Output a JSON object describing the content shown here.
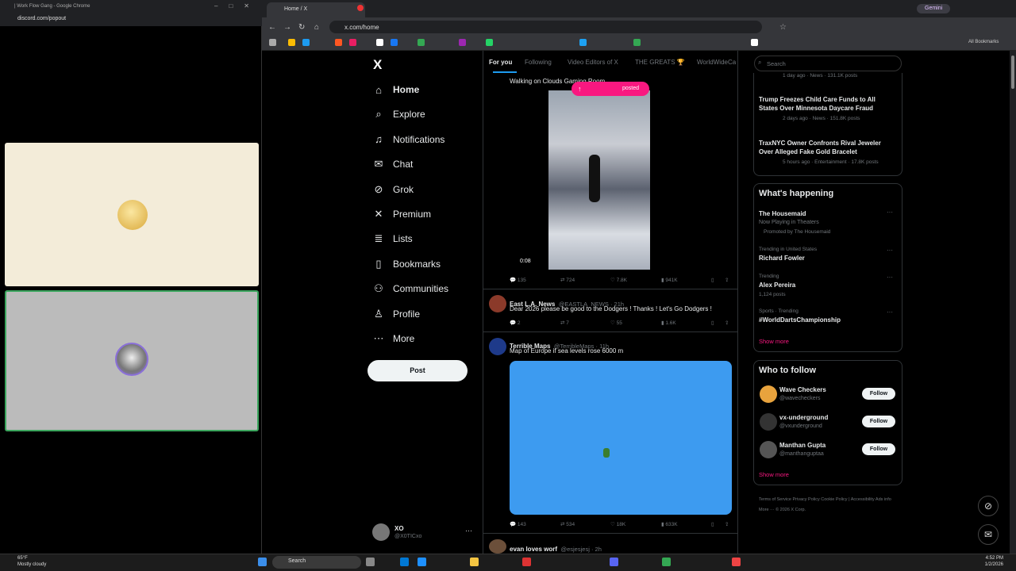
{
  "discord_window": {
    "title": "| Work Flow Gang - Google Chrome",
    "url": "discord.com/popout"
  },
  "browser": {
    "tab_title": "Home / X",
    "url": "x.com/home",
    "gemini_label": "Gemini",
    "all_bookmarks_label": "All Bookmarks"
  },
  "sidebar": {
    "items": [
      {
        "label": "Home",
        "icon": "home-icon"
      },
      {
        "label": "Explore",
        "icon": "search-icon"
      },
      {
        "label": "Notifications",
        "icon": "bell-icon"
      },
      {
        "label": "Chat",
        "icon": "mail-icon"
      },
      {
        "label": "Grok",
        "icon": "grok-icon"
      },
      {
        "label": "Premium",
        "icon": "x-icon"
      },
      {
        "label": "Lists",
        "icon": "list-icon"
      },
      {
        "label": "Bookmarks",
        "icon": "bookmark-icon"
      },
      {
        "label": "Communities",
        "icon": "people-icon"
      },
      {
        "label": "Profile",
        "icon": "person-icon"
      },
      {
        "label": "More",
        "icon": "more-icon"
      }
    ],
    "post_label": "Post",
    "account_name": "XO",
    "account_handle": "@X0TICxo"
  },
  "feed": {
    "tabs": [
      "For you",
      "Following",
      "Video Editors of X",
      "THE GREATS 🏆",
      "WorldWideCa"
    ],
    "posted_pill": "posted",
    "post1": {
      "text": "Walking on Clouds Gaming Room",
      "video_time": "0:08",
      "replies": "135",
      "reposts": "724",
      "likes": "7.8K",
      "views": "941K"
    },
    "post2": {
      "name": "East L.A. News",
      "handle": "@EASTLA_NEWS · 21h",
      "text": "Dear 2026 please be good to the Dodgers ! Thanks ! Let's Go Dodgers !",
      "replies": "2",
      "reposts": "7",
      "likes": "55",
      "views": "1.6K"
    },
    "post3": {
      "name": "Terrible Maps",
      "handle": "@TerribleMaps · 11h",
      "text": "Map of Europe if sea levels rose 6000 m",
      "replies": "143",
      "reposts": "534",
      "likes": "18K",
      "views": "633K"
    },
    "post4": {
      "name": "evan loves worf",
      "handle": "@esjesjesj · 2h"
    }
  },
  "right": {
    "search_placeholder": "Search",
    "news": [
      {
        "meta": "1 day ago · News · 131.1K posts"
      },
      {
        "title": "Trump Freezes Child Care Funds to All States Over Minnesota Daycare Fraud",
        "meta": "2 days ago · News · 151.8K posts"
      },
      {
        "title": "TraxNYC Owner Confronts Rival Jeweler Over Alleged Fake Gold Bracelet",
        "meta": "5 hours ago · Entertainment · 17.8K posts"
      }
    ],
    "happening_title": "What's happening",
    "trends": [
      {
        "title": "The Housemaid",
        "sub": "Now Playing in Theaters",
        "meta": "Promoted by The Housemaid"
      },
      {
        "context": "Trending in United States",
        "title": "Richard Fowler"
      },
      {
        "context": "Trending",
        "title": "Alex Pereira",
        "meta": "1,124 posts"
      },
      {
        "context": "Sports · Trending",
        "title": "#WorldDartsChampionship"
      }
    ],
    "show_more": "Show more",
    "who_title": "Who to follow",
    "follows": [
      {
        "name": "Wave Checkers",
        "handle": "@wavecheckers"
      },
      {
        "name": "vx-underground",
        "handle": "@vxunderground"
      },
      {
        "name": "Manthan Gupta",
        "handle": "@manthanguptaa"
      }
    ],
    "follow_label": "Follow",
    "footer": "Terms of Service   Privacy Policy   Cookie Policy | Accessibility   Ads info   More ···   © 2026 X Corp."
  },
  "taskbar": {
    "search_label": "Search",
    "weather_temp": "65°F",
    "weather_desc": "Mostly cloudy",
    "time": "4:52 PM",
    "date": "1/2/2026"
  },
  "colors": {
    "accent": "#f91880",
    "map_blue": "#3d9bf0",
    "follow_bg": "#eff3f4"
  }
}
